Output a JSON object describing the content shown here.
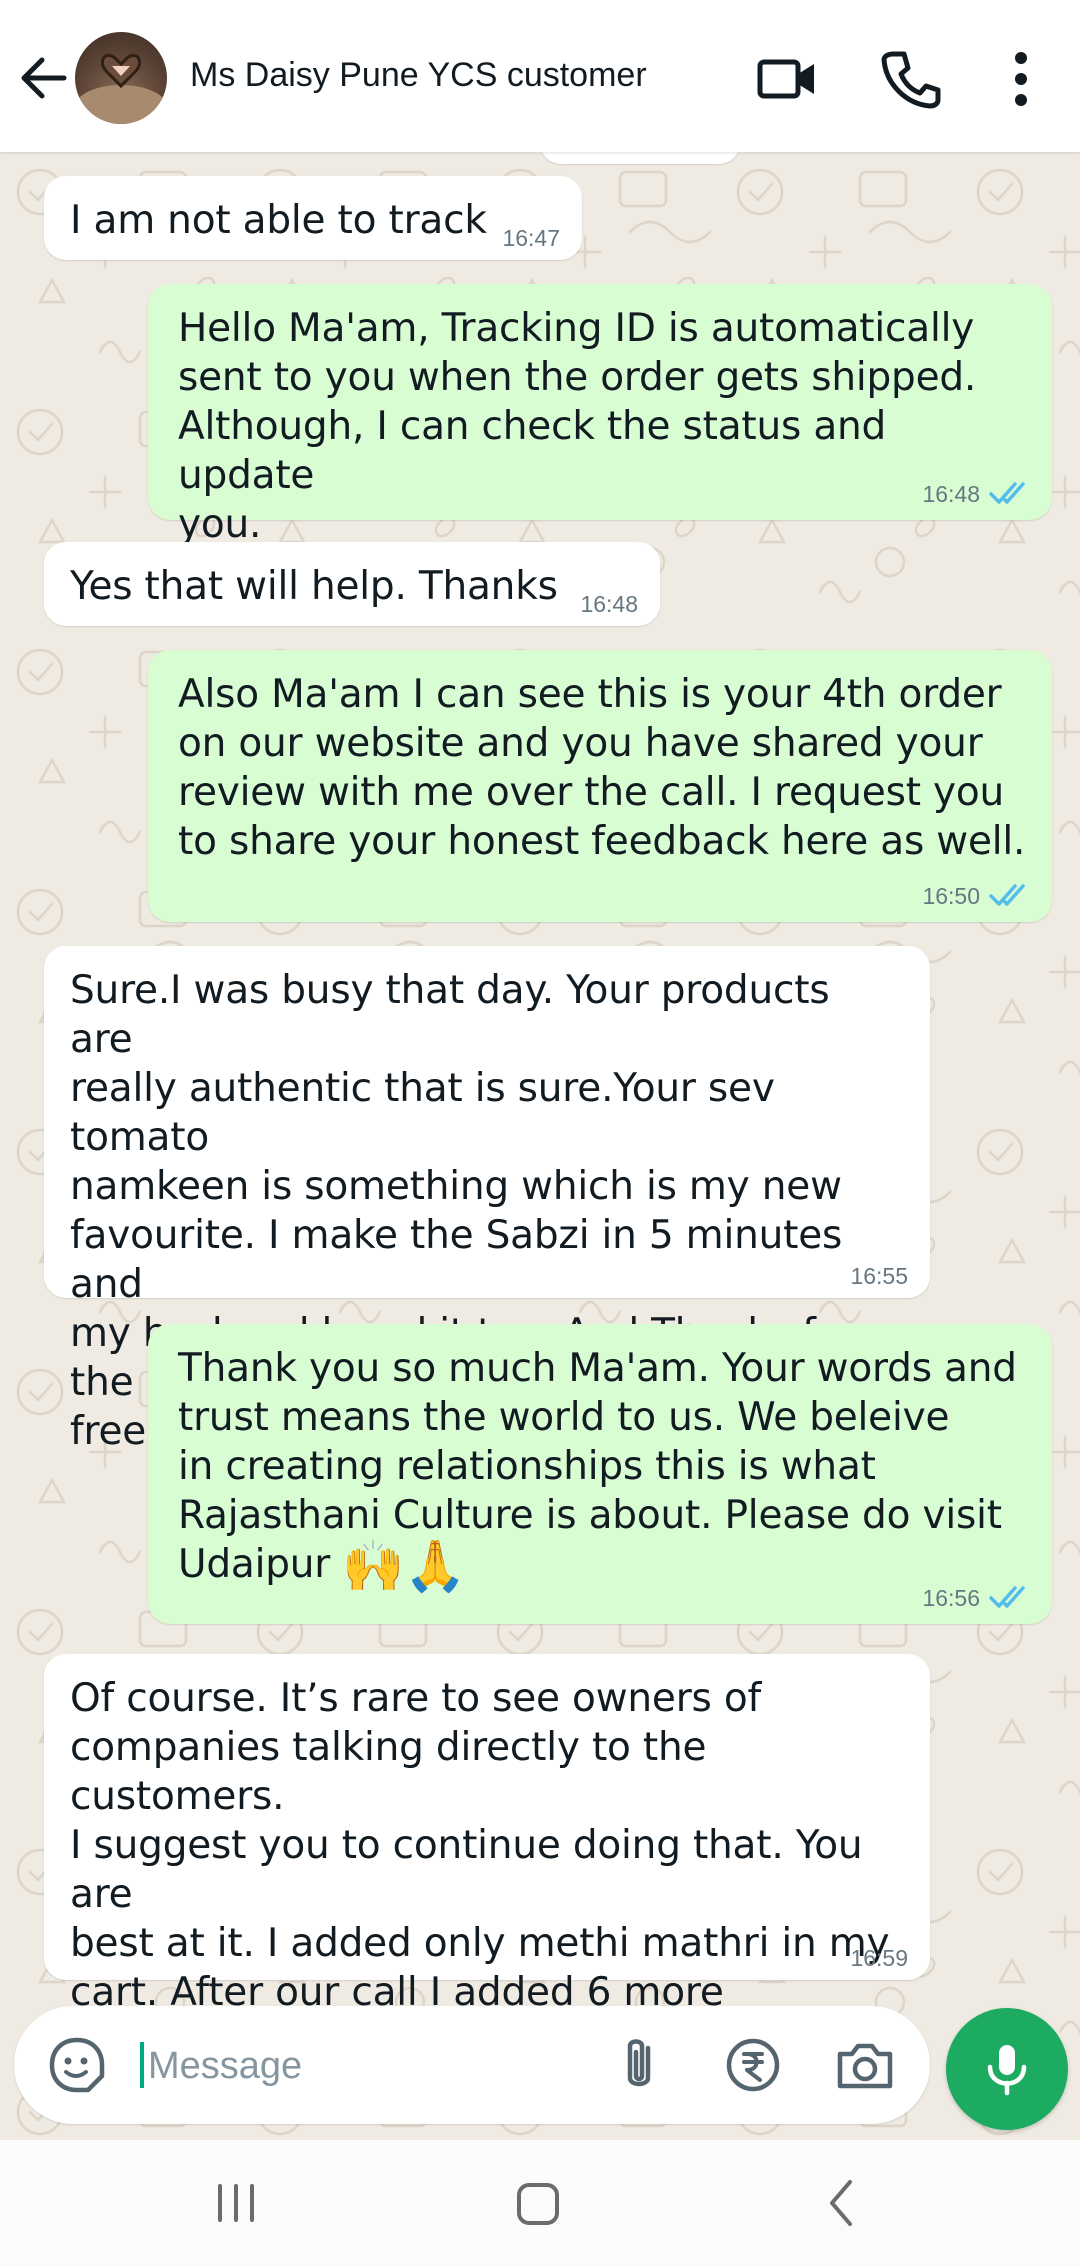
{
  "header": {
    "contact_name": "Ms Daisy Pune YCS customer",
    "icons": [
      "back-arrow-icon",
      "video-call-icon",
      "voice-call-icon",
      "more-options-icon"
    ]
  },
  "messages": [
    {
      "direction": "in",
      "text": "I am not able to track",
      "time": "16:47"
    },
    {
      "direction": "out",
      "text": "Hello  Ma'am, Tracking ID is automatically\nsent to you when the order gets shipped.\nAlthough, I can check the status and update\nyou.",
      "time": "16:48",
      "status": "read"
    },
    {
      "direction": "in",
      "text": "Yes that will help. Thanks",
      "time": "16:48"
    },
    {
      "direction": "out",
      "text": "Also Ma'am I can see this is your 4th order\non our website and you have shared your\nreview with me over the call.  I request you\nto share your honest feedback here as well.",
      "time": "16:50",
      "status": "read"
    },
    {
      "direction": "in",
      "text": "Sure.I was busy that day. Your products are\nreally authentic that is sure.Your sev tomato\nnamkeen is something which is my new\nfavourite. I make the Sabzi in 5 minutes and\nmy husband loved it too. And Thanks for the\nfree treats",
      "emoji": "☺️",
      "time": "16:55"
    },
    {
      "direction": "out",
      "text": "Thank you so much Ma'am.  Your words and\ntrust means the world to us. We beleive\nin creating relationships this is what\nRajasthani Culture is about. Please do visit\nUdaipur",
      "emoji": "🙌🙏",
      "time": "16:56",
      "status": "read"
    },
    {
      "direction": "in",
      "text": "Of course. It’s rare to see owners of\ncompanies talking directly to the customers.\nI suggest you to continue doing that. You are\nbest at it. I added only methi mathri in my\ncart. After our call I added 6 more products\nand it was the best decision.",
      "time": "16:59"
    }
  ],
  "composer": {
    "placeholder": "Message",
    "value": "",
    "icons": [
      "sticker-icon",
      "attach-icon",
      "rupee-payment-icon",
      "camera-icon",
      "mic-icon"
    ]
  },
  "navbar": {
    "icons": [
      "recent-apps-icon",
      "home-icon",
      "back-icon"
    ]
  },
  "colors": {
    "outgoing_bubble": "#d9fdd3",
    "incoming_bubble": "#ffffff",
    "chat_background": "#efeae2",
    "read_ticks": "#53bdeb",
    "mic_button": "#1daa61",
    "cursor": "#00a884"
  }
}
